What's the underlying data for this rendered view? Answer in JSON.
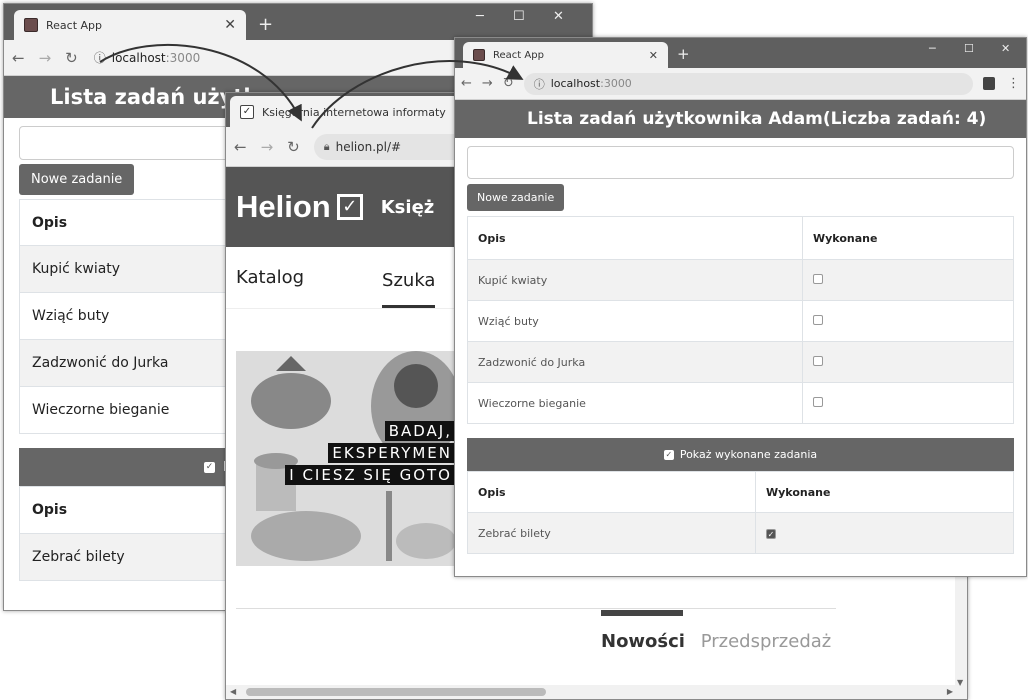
{
  "react_tab_title": "React App",
  "helion_tab_title": "Księgarnia internetowa informaty",
  "url_react": {
    "host": "localhost",
    "port": ":3000"
  },
  "url_helion": "helion.pl/#",
  "app": {
    "title_full": "Lista zadań użytkownika Adam(Liczba zadań: 4)",
    "title_partial": "Lista zadań użytk",
    "new_task_button": "Nowe zadanie",
    "col_description": "Opis",
    "col_done": "Wykonane",
    "tasks": [
      {
        "label": "Kupić kwiaty",
        "done": false
      },
      {
        "label": "Wziąć buty",
        "done": false
      },
      {
        "label": "Zadzwonić do Jurka",
        "done": false
      },
      {
        "label": "Wieczorne bieganie",
        "done": false
      }
    ],
    "toggle_label": "Pokaż wykonane zadania",
    "toggle_partial": "P",
    "completed_tasks": [
      {
        "label": "Zebrać bilety",
        "done": true
      }
    ]
  },
  "helion": {
    "logo": "Helion",
    "logo_cut": "Księż",
    "nav_catalog": "Katalog",
    "nav_search_partial": "Szuka",
    "banner_lines": [
      "BADAJ,",
      "EKSPERYMEN",
      "I CIESZ SIĘ GOTO"
    ],
    "tab_new": "Nowości",
    "tab_presale": "Przedsprzedaż"
  },
  "colors": {
    "header": "#666666",
    "titlebar": "#5f5f5f",
    "stripe": "#f2f2f2"
  }
}
